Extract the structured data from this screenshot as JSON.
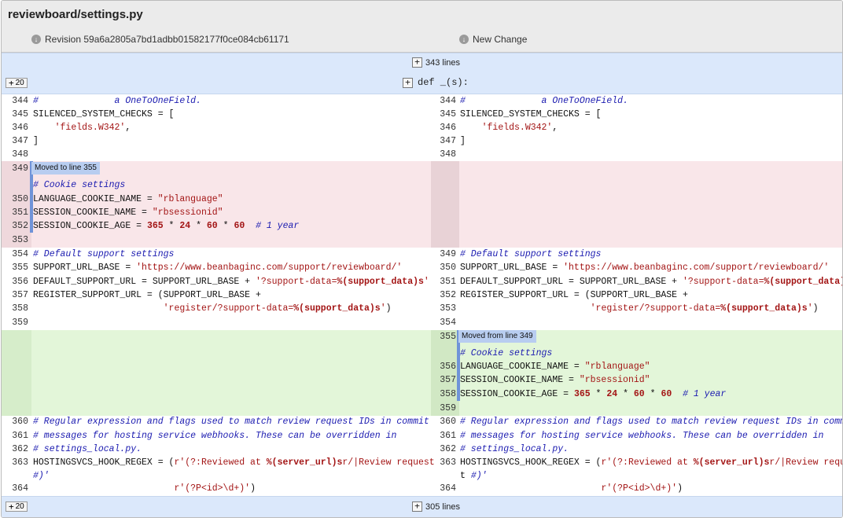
{
  "file": {
    "name": "reviewboard/settings.py"
  },
  "revisions": {
    "left": "Revision 59a6a2805a7bd1adbb01582177f0ce084cb61171",
    "right": "New Change"
  },
  "collapsed_top": {
    "label": "343 lines",
    "expand": "20",
    "function": "def _(s):"
  },
  "collapsed_bottom": {
    "label": "305 lines",
    "expand": "20"
  },
  "moves": {
    "to": "Moved to line 355",
    "from": "Moved from line 349"
  },
  "colors": {
    "deleted": "#f9e6e9",
    "inserted": "#e3f6d9",
    "collapse": "#dbe8fb",
    "flag": "#b8cdf0"
  },
  "left_lines": [
    {
      "n": "344",
      "text": "#              a OneToOneField."
    },
    {
      "n": "345",
      "text": "SILENCED_SYSTEM_CHECKS = ["
    },
    {
      "n": "346",
      "text": "    'fields.W342',"
    },
    {
      "n": "347",
      "text": "]"
    },
    {
      "n": "348",
      "text": ""
    },
    {
      "n": "349",
      "text": ""
    },
    {
      "n": "",
      "text": "# Cookie settings"
    },
    {
      "n": "350",
      "text": "LANGUAGE_COOKIE_NAME = \"rblanguage\""
    },
    {
      "n": "351",
      "text": "SESSION_COOKIE_NAME = \"rbsessionid\""
    },
    {
      "n": "352",
      "text": "SESSION_COOKIE_AGE = 365 * 24 * 60 * 60  # 1 year"
    },
    {
      "n": "353",
      "text": ""
    },
    {
      "n": "354",
      "text": "# Default support settings"
    },
    {
      "n": "355",
      "text": "SUPPORT_URL_BASE = 'https://www.beanbaginc.com/support/reviewboard/'"
    },
    {
      "n": "356",
      "text": "DEFAULT_SUPPORT_URL = SUPPORT_URL_BASE + '?support-data=%(support_data)s'"
    },
    {
      "n": "357",
      "text": "REGISTER_SUPPORT_URL = (SUPPORT_URL_BASE +"
    },
    {
      "n": "358",
      "text": "                        'register/?support-data=%(support_data)s')"
    },
    {
      "n": "359",
      "text": ""
    },
    {
      "n": "360",
      "text": "# Regular expression and flags used to match review request IDs in commit"
    },
    {
      "n": "361",
      "text": "# messages for hosting service webhooks. These can be overridden in"
    },
    {
      "n": "362",
      "text": "# settings_local.py."
    },
    {
      "n": "363",
      "text": "HOSTINGSVCS_HOOK_REGEX = (r'(?:Reviewed at %(server_url)sr/|Review request"
    },
    {
      "n": "",
      "text": "#)'"
    },
    {
      "n": "364",
      "text": "                          r'(?P<id>\\d+)')"
    }
  ],
  "right_lines": [
    {
      "n": "344",
      "text": "#              a OneToOneField."
    },
    {
      "n": "345",
      "text": "SILENCED_SYSTEM_CHECKS = ["
    },
    {
      "n": "346",
      "text": "    'fields.W342',"
    },
    {
      "n": "347",
      "text": "]"
    },
    {
      "n": "348",
      "text": ""
    },
    {
      "n": "349",
      "text": "# Default support settings"
    },
    {
      "n": "350",
      "text": "SUPPORT_URL_BASE = 'https://www.beanbaginc.com/support/reviewboard/'"
    },
    {
      "n": "351",
      "text": "DEFAULT_SUPPORT_URL = SUPPORT_URL_BASE + '?support-data=%(support_data)s'"
    },
    {
      "n": "352",
      "text": "REGISTER_SUPPORT_URL = (SUPPORT_URL_BASE +"
    },
    {
      "n": "353",
      "text": "                        'register/?support-data=%(support_data)s')"
    },
    {
      "n": "354",
      "text": ""
    },
    {
      "n": "355",
      "text": ""
    },
    {
      "n": "",
      "text": "# Cookie settings"
    },
    {
      "n": "356",
      "text": "LANGUAGE_COOKIE_NAME = \"rblanguage\""
    },
    {
      "n": "357",
      "text": "SESSION_COOKIE_NAME = \"rbsessionid\""
    },
    {
      "n": "358",
      "text": "SESSION_COOKIE_AGE = 365 * 24 * 60 * 60  # 1 year"
    },
    {
      "n": "359",
      "text": ""
    },
    {
      "n": "360",
      "text": "# Regular expression and flags used to match review request IDs in commit"
    },
    {
      "n": "361",
      "text": "# messages for hosting service webhooks. These can be overridden in"
    },
    {
      "n": "362",
      "text": "# settings_local.py."
    },
    {
      "n": "363",
      "text": "HOSTINGSVCS_HOOK_REGEX = (r'(?:Reviewed at %(server_url)sr/|Review reques"
    },
    {
      "n": "",
      "text": "t #)'"
    },
    {
      "n": "364",
      "text": "                          r'(?P<id>\\d+)')"
    }
  ]
}
